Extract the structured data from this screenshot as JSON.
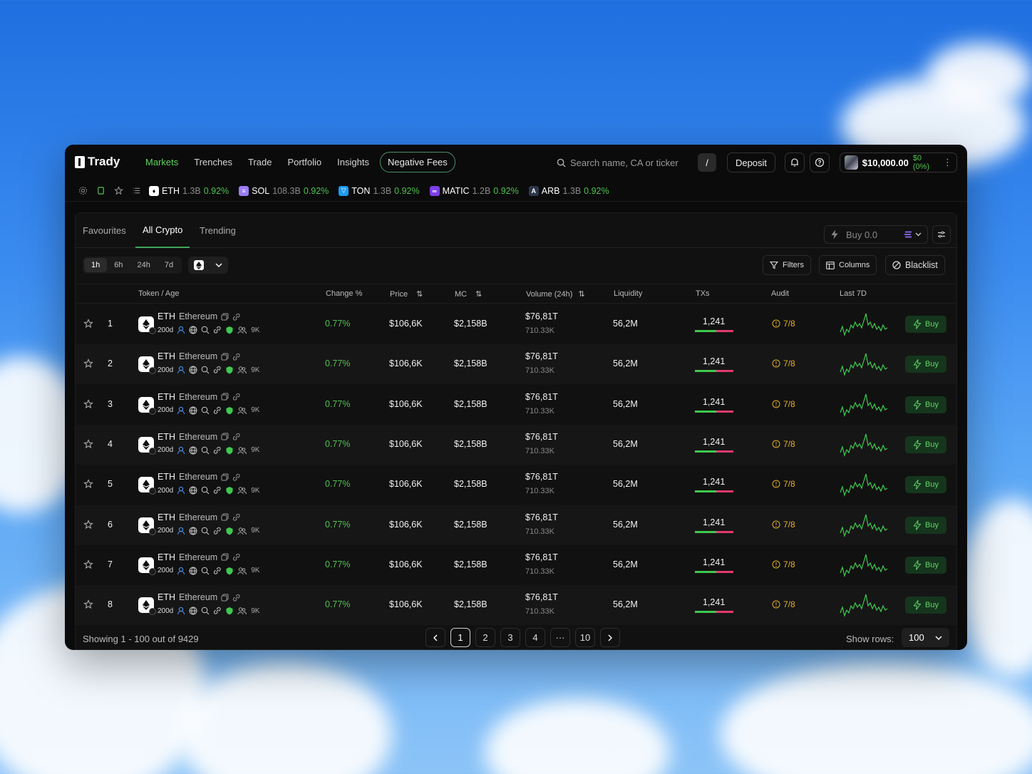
{
  "app": {
    "name": "Trady"
  },
  "nav": [
    {
      "label": "Markets",
      "active": true
    },
    {
      "label": "Trenches"
    },
    {
      "label": "Trade"
    },
    {
      "label": "Portfolio"
    },
    {
      "label": "Insights"
    },
    {
      "label": "Negative Fees",
      "pill": true
    }
  ],
  "search": {
    "placeholder": "Search name, CA or ticker",
    "shortcut": "/"
  },
  "header": {
    "deposit_label": "Deposit",
    "balance": "$10,000.00",
    "pnl": "$0 (0%)"
  },
  "tickers": [
    {
      "symbol": "ETH",
      "mc": "1.3B",
      "change": "0.92%",
      "logo_color": "#ffffff",
      "logo_glyph": "♦"
    },
    {
      "symbol": "SOL",
      "mc": "108.3B",
      "change": "0.92%",
      "logo_color": "#9b7cf5",
      "logo_glyph": "≡"
    },
    {
      "symbol": "TON",
      "mc": "1.3B",
      "change": "0.92%",
      "logo_color": "#1e9bf0",
      "logo_glyph": "▽"
    },
    {
      "symbol": "MATIC",
      "mc": "1.2B",
      "change": "0.92%",
      "logo_color": "#7b3fe4",
      "logo_glyph": "∞"
    },
    {
      "symbol": "ARB",
      "mc": "1.3B",
      "change": "0.92%",
      "logo_color": "#2d374b",
      "logo_glyph": "A"
    }
  ],
  "tabs": [
    "Favourites",
    "All Crypto",
    "Trending"
  ],
  "active_tab": "All Crypto",
  "quick_buy": {
    "label": "Buy 0.0"
  },
  "timeframes": [
    "1h",
    "6h",
    "24h",
    "7d"
  ],
  "active_timeframe": "1h",
  "toolbar": {
    "filters": "Filters",
    "columns": "Columns",
    "blacklist": "Blacklist"
  },
  "columns": {
    "token": "Token / Age",
    "change": "Change %",
    "price": "Price",
    "mc": "MC",
    "volume": "Volume (24h)",
    "liquidity": "Liquidity",
    "txs": "TXs",
    "audit": "Audit",
    "last7d": "Last 7D"
  },
  "rows": [
    {
      "rank": "1",
      "symbol": "ETH",
      "name": "Ethereum",
      "age": "200d",
      "holders": "9K",
      "change": "0.77%",
      "price": "$106,6K",
      "mc": "$2,158B",
      "volume": "$76,81T",
      "volume_sub": "710.33K",
      "liquidity": "56,2M",
      "txs": "1,241",
      "buy_share": 0.55,
      "audit": "7/8",
      "buy": "Buy"
    },
    {
      "rank": "2",
      "symbol": "ETH",
      "name": "Ethereum",
      "age": "200d",
      "holders": "9K",
      "change": "0.77%",
      "price": "$106,6K",
      "mc": "$2,158B",
      "volume": "$76,81T",
      "volume_sub": "710.33K",
      "liquidity": "56,2M",
      "txs": "1,241",
      "buy_share": 0.55,
      "audit": "7/8",
      "buy": "Buy"
    },
    {
      "rank": "3",
      "symbol": "ETH",
      "name": "Ethereum",
      "age": "200d",
      "holders": "9K",
      "change": "0.77%",
      "price": "$106,6K",
      "mc": "$2,158B",
      "volume": "$76,81T",
      "volume_sub": "710.33K",
      "liquidity": "56,2M",
      "txs": "1,241",
      "buy_share": 0.55,
      "audit": "7/8",
      "buy": "Buy"
    },
    {
      "rank": "4",
      "symbol": "ETH",
      "name": "Ethereum",
      "age": "200d",
      "holders": "9K",
      "change": "0.77%",
      "price": "$106,6K",
      "mc": "$2,158B",
      "volume": "$76,81T",
      "volume_sub": "710.33K",
      "liquidity": "56,2M",
      "txs": "1,241",
      "buy_share": 0.55,
      "audit": "7/8",
      "buy": "Buy"
    },
    {
      "rank": "5",
      "symbol": "ETH",
      "name": "Ethereum",
      "age": "200d",
      "holders": "9K",
      "change": "0.77%",
      "price": "$106,6K",
      "mc": "$2,158B",
      "volume": "$76,81T",
      "volume_sub": "710.33K",
      "liquidity": "56,2M",
      "txs": "1,241",
      "buy_share": 0.55,
      "audit": "7/8",
      "buy": "Buy"
    },
    {
      "rank": "6",
      "symbol": "ETH",
      "name": "Ethereum",
      "age": "200d",
      "holders": "9K",
      "change": "0.77%",
      "price": "$106,6K",
      "mc": "$2,158B",
      "volume": "$76,81T",
      "volume_sub": "710.33K",
      "liquidity": "56,2M",
      "txs": "1,241",
      "buy_share": 0.55,
      "audit": "7/8",
      "buy": "Buy"
    },
    {
      "rank": "7",
      "symbol": "ETH",
      "name": "Ethereum",
      "age": "200d",
      "holders": "9K",
      "change": "0.77%",
      "price": "$106,6K",
      "mc": "$2,158B",
      "volume": "$76,81T",
      "volume_sub": "710.33K",
      "liquidity": "56,2M",
      "txs": "1,241",
      "buy_share": 0.55,
      "audit": "7/8",
      "buy": "Buy"
    },
    {
      "rank": "8",
      "symbol": "ETH",
      "name": "Ethereum",
      "age": "200d",
      "holders": "9K",
      "change": "0.77%",
      "price": "$106,6K",
      "mc": "$2,158B",
      "volume": "$76,81T",
      "volume_sub": "710.33K",
      "liquidity": "56,2M",
      "txs": "1,241",
      "buy_share": 0.55,
      "audit": "7/8",
      "buy": "Buy"
    }
  ],
  "footer": {
    "showing": "Showing 1 - 100 out of 9429",
    "pages": [
      "1",
      "2",
      "3",
      "4",
      "···",
      "10"
    ],
    "active_page": "1",
    "rows_label": "Show rows:",
    "rows_value": "100"
  },
  "colors": {
    "accent_green": "#4fc14f",
    "sell_red": "#e23a6e",
    "audit_amber": "#e3b02a"
  }
}
